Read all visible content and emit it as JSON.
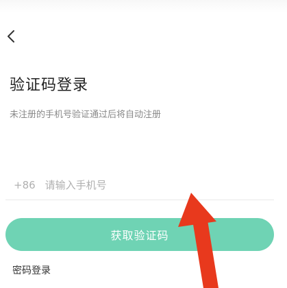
{
  "header": {
    "back_icon": "chevron-left-icon"
  },
  "login": {
    "title": "验证码登录",
    "subtitle": "未注册的手机号验证通过后将自动注册",
    "country_code": "+86",
    "phone_placeholder": "请输入手机号",
    "phone_value": "",
    "submit_label": "获取验证码",
    "alt_login_label": "密码登录"
  },
  "colors": {
    "accent": "#6fd3b4",
    "annotation_arrow": "#e8391d",
    "title_text": "#222222",
    "muted_text": "#888888"
  }
}
